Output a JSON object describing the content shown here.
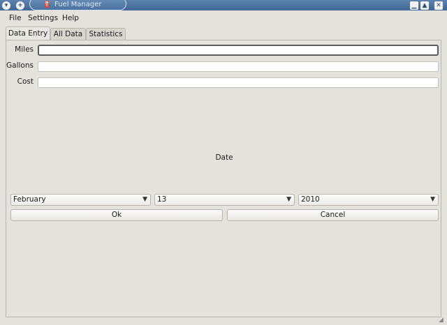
{
  "window": {
    "title": "Fuel Manager"
  },
  "menu": {
    "file": "File",
    "settings": "Settings",
    "help": "Help"
  },
  "tabs": [
    "Data Entry",
    "All Data",
    "Statistics"
  ],
  "form": {
    "miles_label": "Miles",
    "gallons_label": "Gallons",
    "cost_label": "Cost",
    "miles_value": "",
    "gallons_value": "",
    "cost_value": ""
  },
  "date": {
    "label": "Date",
    "month": "February",
    "day": "13",
    "year": "2010"
  },
  "buttons": {
    "ok": "Ok",
    "cancel": "Cancel"
  },
  "icons": {
    "titlebar_menu": "chevron-down-icon",
    "titlebar_pin": "plus-icon",
    "app": "fuel-pump-icon",
    "minimize": "minimize-icon",
    "maximize": "maximize-icon",
    "close": "close-icon",
    "dropdown": "chevron-down-icon",
    "resize": "resize-grip-icon"
  }
}
